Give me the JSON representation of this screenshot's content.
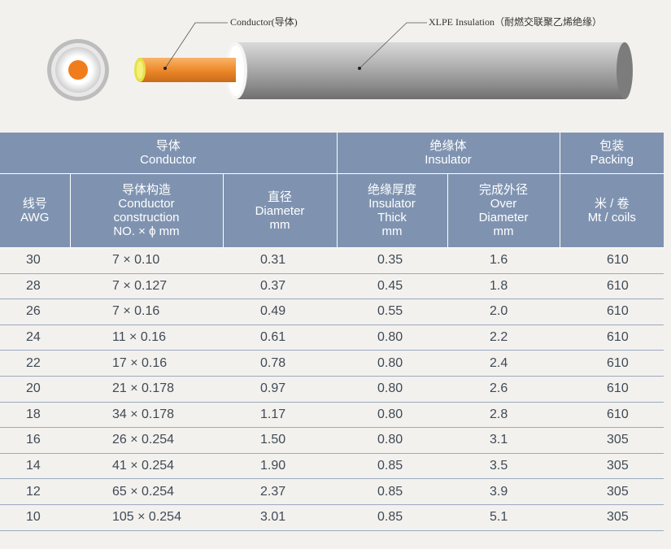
{
  "diagram": {
    "conductor_label": "Conductor(导体)",
    "insulation_label": "XLPE Insulation（耐燃交联聚乙烯绝缘）"
  },
  "table": {
    "groups": [
      {
        "cn": "导体",
        "en": "Conductor"
      },
      {
        "cn": "绝缘体",
        "en": "Insulator"
      },
      {
        "cn": "包装",
        "en": "Packing"
      }
    ],
    "columns": [
      {
        "lines": [
          "线号",
          "AWG"
        ]
      },
      {
        "lines": [
          "导体构造",
          "Conductor",
          "construction",
          "NO. × ϕ mm"
        ]
      },
      {
        "lines": [
          "直径",
          "Diameter",
          "mm"
        ]
      },
      {
        "lines": [
          "绝缘厚度",
          "Insulator",
          "Thick",
          "mm"
        ]
      },
      {
        "lines": [
          "完成外径",
          "Over",
          "Diameter",
          "mm"
        ]
      },
      {
        "lines": [
          "米 / 卷",
          "Mt / coils"
        ]
      }
    ],
    "rows": [
      [
        "30",
        "7 × 0.10",
        "0.31",
        "0.35",
        "1.6",
        "610"
      ],
      [
        "28",
        "7 × 0.127",
        "0.37",
        "0.45",
        "1.8",
        "610"
      ],
      [
        "26",
        "7 × 0.16",
        "0.49",
        "0.55",
        "2.0",
        "610"
      ],
      [
        "24",
        "11 × 0.16",
        "0.61",
        "0.80",
        "2.2",
        "610"
      ],
      [
        "22",
        "17 × 0.16",
        "0.78",
        "0.80",
        "2.4",
        "610"
      ],
      [
        "20",
        "21 × 0.178",
        "0.97",
        "0.80",
        "2.6",
        "610"
      ],
      [
        "18",
        "34 × 0.178",
        "1.17",
        "0.80",
        "2.8",
        "610"
      ],
      [
        "16",
        "26 × 0.254",
        "1.50",
        "0.80",
        "3.1",
        "305"
      ],
      [
        "14",
        "41 × 0.254",
        "1.90",
        "0.85",
        "3.5",
        "305"
      ],
      [
        "12",
        "65 × 0.254",
        "2.37",
        "0.85",
        "3.9",
        "305"
      ],
      [
        "10",
        "105 × 0.254",
        "3.01",
        "0.85",
        "5.1",
        "305"
      ]
    ]
  }
}
